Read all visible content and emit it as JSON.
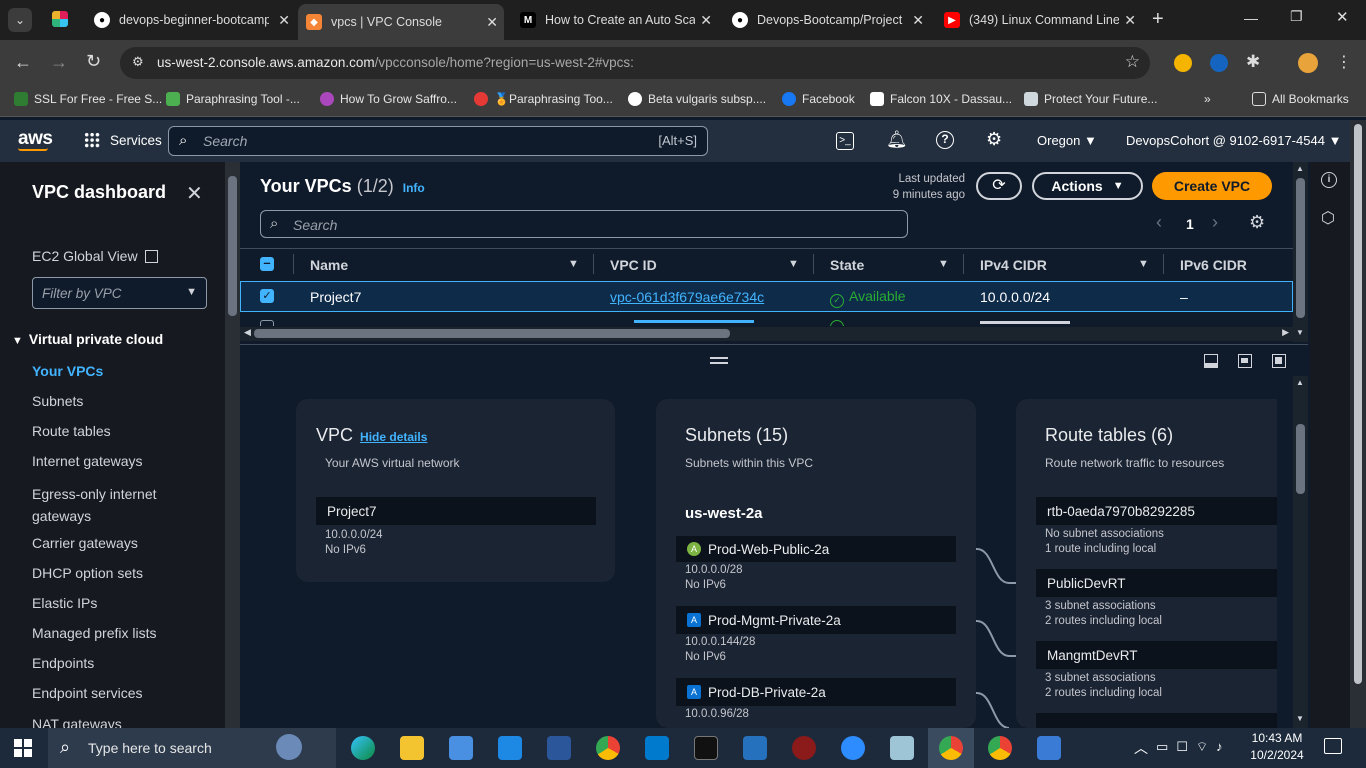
{
  "browser": {
    "tabs": [
      {
        "title": "devops-beginner-bootcamp",
        "icon": "github-icon"
      },
      {
        "title": "vpcs | VPC Console",
        "icon": "aws-icon"
      },
      {
        "title": "How to Create an Auto Scaling",
        "icon": "medium-icon"
      },
      {
        "title": "Devops-Bootcamp/Project",
        "icon": "github-icon"
      },
      {
        "title": "(349) Linux Command Line",
        "icon": "youtube-icon"
      }
    ],
    "url_host": "us-west-2.console.aws.amazon.com",
    "url_path": "/vpcconsole/home?region=us-west-2#vpcs:",
    "bookmarks": [
      "SSL For Free - Free S...",
      "Paraphrasing Tool -...",
      "How To Grow Saffro...",
      "🏅Paraphrasing Too...",
      "Beta vulgaris subsp....",
      "Facebook",
      "Falcon 10X - Dassau...",
      "Protect Your Future..."
    ],
    "all_bookmarks": "All Bookmarks"
  },
  "aws": {
    "services": "Services",
    "search_placeholder": "Search",
    "search_shortcut": "[Alt+S]",
    "region": "Oregon",
    "account": "DevopsCohort @ 9102-6917-4544"
  },
  "sidebar": {
    "title": "VPC dashboard",
    "ec2_global": "EC2 Global View",
    "filter_placeholder": "Filter by VPC",
    "section": "Virtual private cloud",
    "items": [
      "Your VPCs",
      "Subnets",
      "Route tables",
      "Internet gateways",
      "Egress-only internet gateways",
      "Carrier gateways",
      "DHCP option sets",
      "Elastic IPs",
      "Managed prefix lists",
      "Endpoints",
      "Endpoint services",
      "NAT gateways"
    ]
  },
  "vpcs": {
    "title": "Your VPCs",
    "count": "(1/2)",
    "info": "Info",
    "last_updated_label": "Last updated",
    "last_updated_value": "9 minutes ago",
    "actions": "Actions",
    "create": "Create VPC",
    "search_placeholder": "Search",
    "page": "1",
    "columns": [
      "Name",
      "VPC ID",
      "State",
      "IPv4 CIDR",
      "IPv6 CIDR"
    ],
    "rows": [
      {
        "name": "Project7",
        "vpc_id": "vpc-061d3f679ae6e734c",
        "state": "Available",
        "ipv4": "10.0.0.0/24",
        "ipv6": "–"
      }
    ]
  },
  "detail": {
    "vpc": {
      "title": "VPC",
      "hide": "Hide details",
      "sub": "Your AWS virtual network",
      "name": "Project7",
      "cidr": "10.0.0.0/24",
      "ipv6": "No IPv6"
    },
    "subnets": {
      "title": "Subnets (15)",
      "sub": "Subnets within this VPC",
      "az": "us-west-2a",
      "items": [
        {
          "badge": "A",
          "name": "Prod-Web-Public-2a",
          "cidr": "10.0.0.0/28",
          "ipv6": "No IPv6",
          "color": "#7cb342"
        },
        {
          "badge": "A",
          "name": "Prod-Mgmt-Private-2a",
          "cidr": "10.0.0.144/28",
          "ipv6": "No IPv6",
          "color": "#0972d3"
        },
        {
          "badge": "A",
          "name": "Prod-DB-Private-2a",
          "cidr": "10.0.0.96/28",
          "ipv6": "",
          "color": "#0972d3"
        }
      ]
    },
    "routes": {
      "title": "Route tables (6)",
      "sub": "Route network traffic to resources",
      "items": [
        {
          "name": "rtb-0aeda7970b8292285",
          "l1": "No subnet associations",
          "l2": "1 route including local"
        },
        {
          "name": "PublicDevRT",
          "l1": "3 subnet associations",
          "l2": "2 routes including local"
        },
        {
          "name": "MangmtDevRT",
          "l1": "3 subnet associations",
          "l2": "2 routes including local"
        }
      ]
    }
  },
  "taskbar": {
    "search": "Type here to search",
    "time": "10:43 AM",
    "date": "10/2/2024"
  },
  "colors": {
    "accent": "#ff9900",
    "link": "#42b4ff",
    "available": "#29ad32"
  }
}
